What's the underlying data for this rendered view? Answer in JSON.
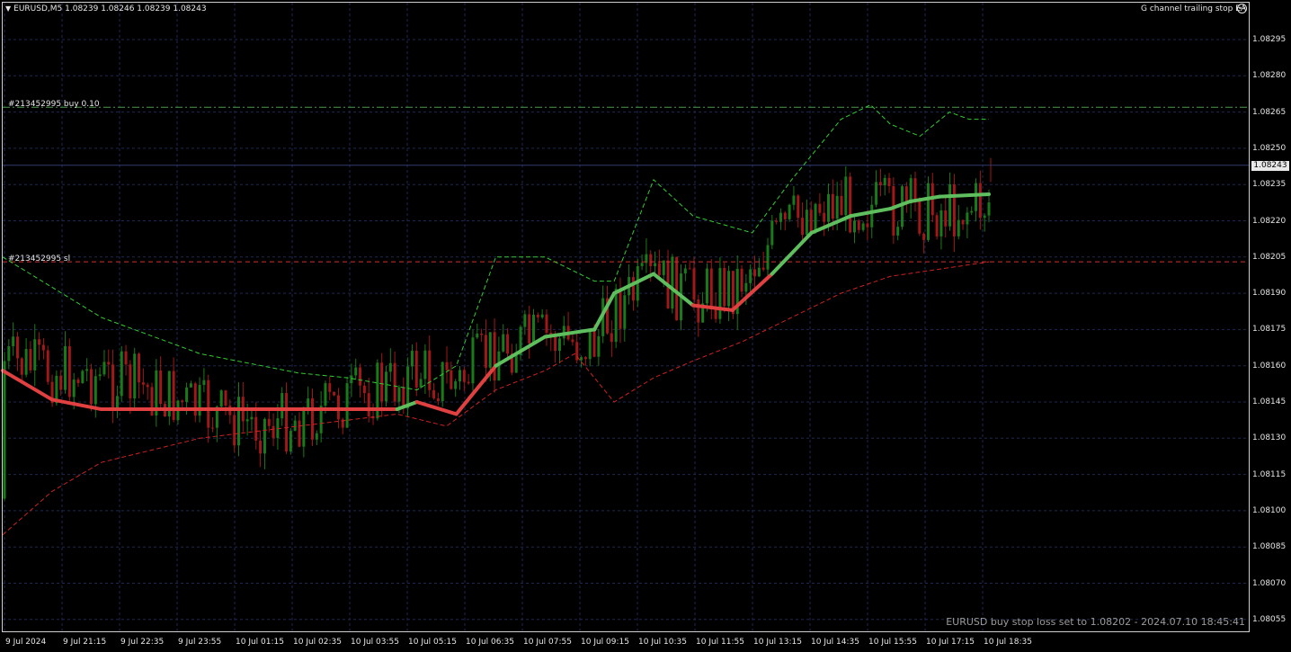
{
  "window": {
    "symbol_header": "EURUSD,M5  1.08239 1.08246 1.08239 1.08243",
    "expert_name": "G channel trailing stop EA",
    "expert_icon": "smiley-face-icon",
    "status_message": "EURUSD buy stop loss set to 1.08202 - 2024.07.10 18:45:41"
  },
  "orders": {
    "entry_label": "#213452995 buy 0.10",
    "entry_price": 1.08267,
    "sl_label": "#213452995 sl",
    "sl_price": 1.08203
  },
  "current_price": "1.08243",
  "price_axis": [
    "1.08295",
    "1.08280",
    "1.08265",
    "1.08250",
    "1.08235",
    "1.08220",
    "1.08205",
    "1.08190",
    "1.08175",
    "1.08160",
    "1.08145",
    "1.08130",
    "1.08115",
    "1.08100",
    "1.08085",
    "1.08070",
    "1.08055"
  ],
  "time_axis": [
    "9 Jul 2024",
    "9 Jul 21:15",
    "9 Jul 22:35",
    "9 Jul 23:55",
    "10 Jul 01:15",
    "10 Jul 02:35",
    "10 Jul 03:55",
    "10 Jul 05:15",
    "10 Jul 06:35",
    "10 Jul 07:55",
    "10 Jul 09:15",
    "10 Jul 10:35",
    "10 Jul 11:55",
    "10 Jul 13:15",
    "10 Jul 14:35",
    "10 Jul 15:55",
    "10 Jul 17:15",
    "10 Jul 18:35"
  ],
  "colors": {
    "background": "#000000",
    "grid": "#1e2850",
    "bull_candle": "#1a7a1a",
    "bear_candle": "#a01818",
    "channel_up": "#5fbf5f",
    "channel_down": "#e04040",
    "upper_band": "#33cc33",
    "lower_band": "#cc2222",
    "order_line": "#4c9a4c",
    "sl_line": "#d03030",
    "bid_line": "#303a70"
  },
  "chart_data": {
    "type": "candlestick",
    "symbol": "EURUSD",
    "timeframe": "M5",
    "last_bar": {
      "open": 1.08239,
      "high": 1.08246,
      "low": 1.08239,
      "close": 1.08243
    },
    "ylim": [
      1.0805,
      1.08305
    ],
    "grid": true,
    "overlays": {
      "trend_line": {
        "x_frac": [
          0.0,
          0.05,
          0.1,
          0.2,
          0.3,
          0.4,
          0.42,
          0.46,
          0.5,
          0.55,
          0.6,
          0.62,
          0.66,
          0.7,
          0.74,
          0.78,
          0.82,
          0.86,
          0.9,
          0.92,
          0.95,
          1.0
        ],
        "price": [
          1.08158,
          1.08146,
          1.08142,
          1.08142,
          1.08142,
          1.08142,
          1.08145,
          1.0814,
          1.0816,
          1.08172,
          1.08175,
          1.0819,
          1.08198,
          1.08185,
          1.08183,
          1.08198,
          1.08215,
          1.08222,
          1.08225,
          1.08228,
          1.0823,
          1.08231
        ],
        "direction": [
          "down",
          "down",
          "down",
          "down",
          "down",
          "up",
          "down",
          "down",
          "up",
          "up",
          "up",
          "up",
          "up",
          "down",
          "down",
          "up",
          "up",
          "up",
          "up",
          "up",
          "up",
          "up"
        ]
      },
      "upper_band": {
        "x_frac": [
          0.0,
          0.1,
          0.2,
          0.3,
          0.35,
          0.42,
          0.46,
          0.5,
          0.55,
          0.6,
          0.62,
          0.66,
          0.7,
          0.76,
          0.8,
          0.85,
          0.88,
          0.9,
          0.93,
          0.96,
          0.98,
          1.0
        ],
        "price": [
          1.08205,
          1.0818,
          1.08165,
          1.08157,
          1.08155,
          1.0815,
          1.0816,
          1.08205,
          1.08205,
          1.08195,
          1.08195,
          1.08237,
          1.08222,
          1.08215,
          1.08237,
          1.08262,
          1.08268,
          1.0826,
          1.08255,
          1.08265,
          1.08262,
          1.08262
        ]
      },
      "lower_band": {
        "x_frac": [
          0.0,
          0.05,
          0.1,
          0.2,
          0.3,
          0.4,
          0.45,
          0.5,
          0.55,
          0.58,
          0.62,
          0.66,
          0.7,
          0.75,
          0.8,
          0.85,
          0.9,
          0.95,
          1.0
        ],
        "price": [
          1.0809,
          1.08108,
          1.0812,
          1.0813,
          1.08135,
          1.0814,
          1.08135,
          1.0815,
          1.08158,
          1.08165,
          1.08145,
          1.08155,
          1.08162,
          1.0817,
          1.0818,
          1.0819,
          1.08197,
          1.082,
          1.08203
        ]
      }
    }
  }
}
